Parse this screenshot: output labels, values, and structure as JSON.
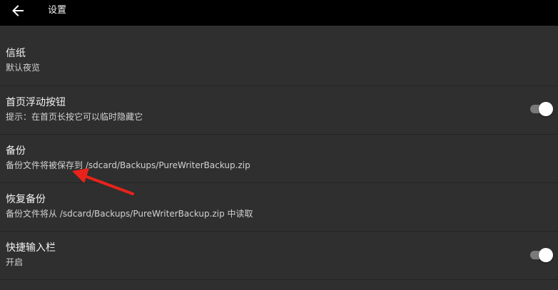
{
  "header": {
    "title": "设置",
    "back_icon": "arrow-left-icon"
  },
  "settings": [
    {
      "title": "信纸",
      "subtitle": "默认夜览",
      "has_toggle": false
    },
    {
      "title": "首页浮动按钮",
      "subtitle": "提示：在首页长按它可以临时隐藏它",
      "has_toggle": true,
      "toggle_on": true
    },
    {
      "title": "备份",
      "subtitle": "备份文件将被保存到 /sdcard/Backups/PureWriterBackup.zip",
      "has_toggle": false
    },
    {
      "title": "恢复备份",
      "subtitle": "备份文件将从 /sdcard/Backups/PureWriterBackup.zip 中读取",
      "has_toggle": false
    },
    {
      "title": "快捷输入栏",
      "subtitle": "开启",
      "has_toggle": true,
      "toggle_on": true
    }
  ],
  "annotation": {
    "color": "#e8231b",
    "icon": "red-arrow-icon"
  }
}
